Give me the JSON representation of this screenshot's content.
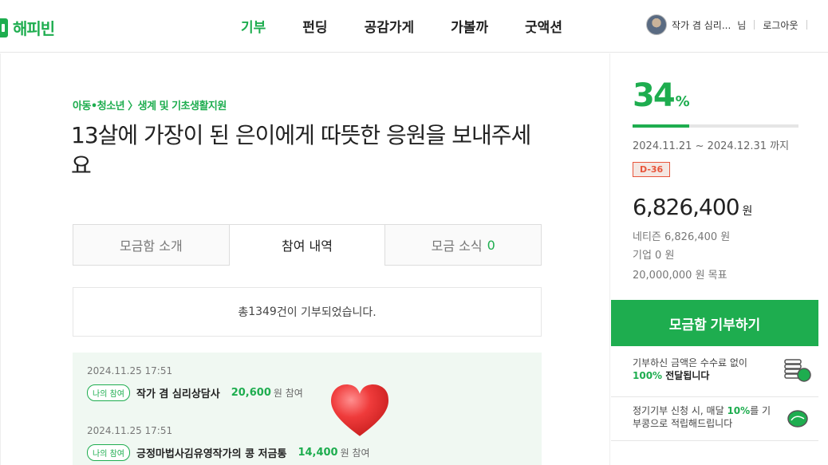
{
  "brand": {
    "name": "해피빈",
    "color": "#1ead4f"
  },
  "nav": {
    "items": [
      {
        "label": "기부",
        "active": true
      },
      {
        "label": "펀딩"
      },
      {
        "label": "공감가게"
      },
      {
        "label": "가볼까"
      },
      {
        "label": "굿액션"
      }
    ]
  },
  "user": {
    "name": "작가 겸 심리...",
    "suffix": "님",
    "logout": "로그아웃"
  },
  "campaign": {
    "category": "아동•청소년 〉생계 및 기초생활지원",
    "title": "13살에 가장이 된 은이에게 따뜻한 응원을 보내주세요"
  },
  "tabs": [
    {
      "label": "모금함 소개"
    },
    {
      "label": "참여 내역",
      "active": true
    },
    {
      "label": "모금 소식",
      "count": "0"
    }
  ],
  "summary": {
    "prefix": "총 ",
    "count": "1349",
    "suffix": "건이 기부되었습니다."
  },
  "donations": [
    {
      "date": "2024.11.25 17:51",
      "badge": "나의 참여",
      "donor": "작가 겸 심리상담사",
      "amount": "20,600",
      "unit": "원 참여"
    },
    {
      "date": "2024.11.25 17:51",
      "badge": "나의 참여",
      "donor": "긍정마법사김유영작가의 콩 저금통",
      "amount": "14,400",
      "unit": "원 참여"
    }
  ],
  "stats": {
    "percent": "34",
    "percent_unit": "%",
    "progress": 0.34,
    "period": "2024.11.21 ~ 2024.12.31 까지",
    "dday": "D-36",
    "total": "6,826,400",
    "total_unit": "원",
    "netizen": "네티즌 6,826,400 원",
    "company": "기업 0 원",
    "goal": "20,000,000 원 목표"
  },
  "donate_button": "모금함 기부하기",
  "info": [
    {
      "text": "기부하신 금액은 수수료 없이",
      "highlight": "100%",
      "tail": " 전달됩니다",
      "icon": "coins-icon"
    },
    {
      "text": "정기기부 신청 시, 매달 ",
      "highlight": "10%",
      "tail": "를 기부콩으로 적립해드립니다",
      "icon": "bean-icon"
    }
  ]
}
